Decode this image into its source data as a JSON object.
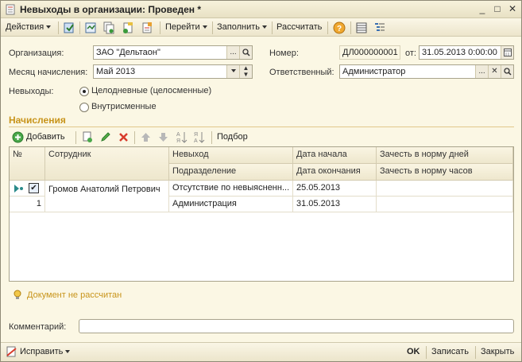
{
  "window": {
    "title": "Невыходы в организации: Проведен *"
  },
  "toolbar": {
    "actions_label": "Действия",
    "goto_label": "Перейти",
    "fill_label": "Заполнить",
    "calculate_label": "Рассчитать"
  },
  "form": {
    "organization_label": "Организация:",
    "organization_value": "ЗАО \"Дельтаон\"",
    "month_label": "Месяц начисления:",
    "month_value": "Май 2013",
    "absences_label": "Невыходы:",
    "radio_fullday": "Целодневные (целосменные)",
    "radio_intraday": "Внутрисменные",
    "number_label": "Номер:",
    "number_value": "ДЛ000000001",
    "from_label": "от:",
    "date_value": "31.05.2013  0:00:00",
    "responsible_label": "Ответственный:",
    "responsible_value": "Администратор"
  },
  "accruals": {
    "section_title": "Начисления",
    "add_label": "Добавить",
    "pick_label": "Подбор",
    "columns": {
      "num": "№",
      "employee": "Сотрудник",
      "absence": "Невыход",
      "department": "Подразделение",
      "date_start": "Дата начала",
      "date_end": "Дата окончания",
      "count_days": "Зачесть в норму дней",
      "count_hours": "Зачесть в норму часов"
    },
    "rows": [
      {
        "num": "1",
        "employee": "Громов Анатолий Петрович",
        "absence": "Отсутствие по невыясненн...",
        "department": "Администрация",
        "date_start": "25.05.2013",
        "date_end": "31.05.2013",
        "count_days": "",
        "count_hours": ""
      }
    ]
  },
  "status": {
    "message": "Документ не рассчитан"
  },
  "comment": {
    "label": "Комментарий:",
    "value": ""
  },
  "bottom": {
    "fix_label": "Исправить",
    "ok_label": "OK",
    "save_label": "Записать",
    "close_label": "Закрыть"
  },
  "colors": {
    "background": "#fbf7e4",
    "section_accent": "#c8941a",
    "border": "#a9a48c"
  }
}
